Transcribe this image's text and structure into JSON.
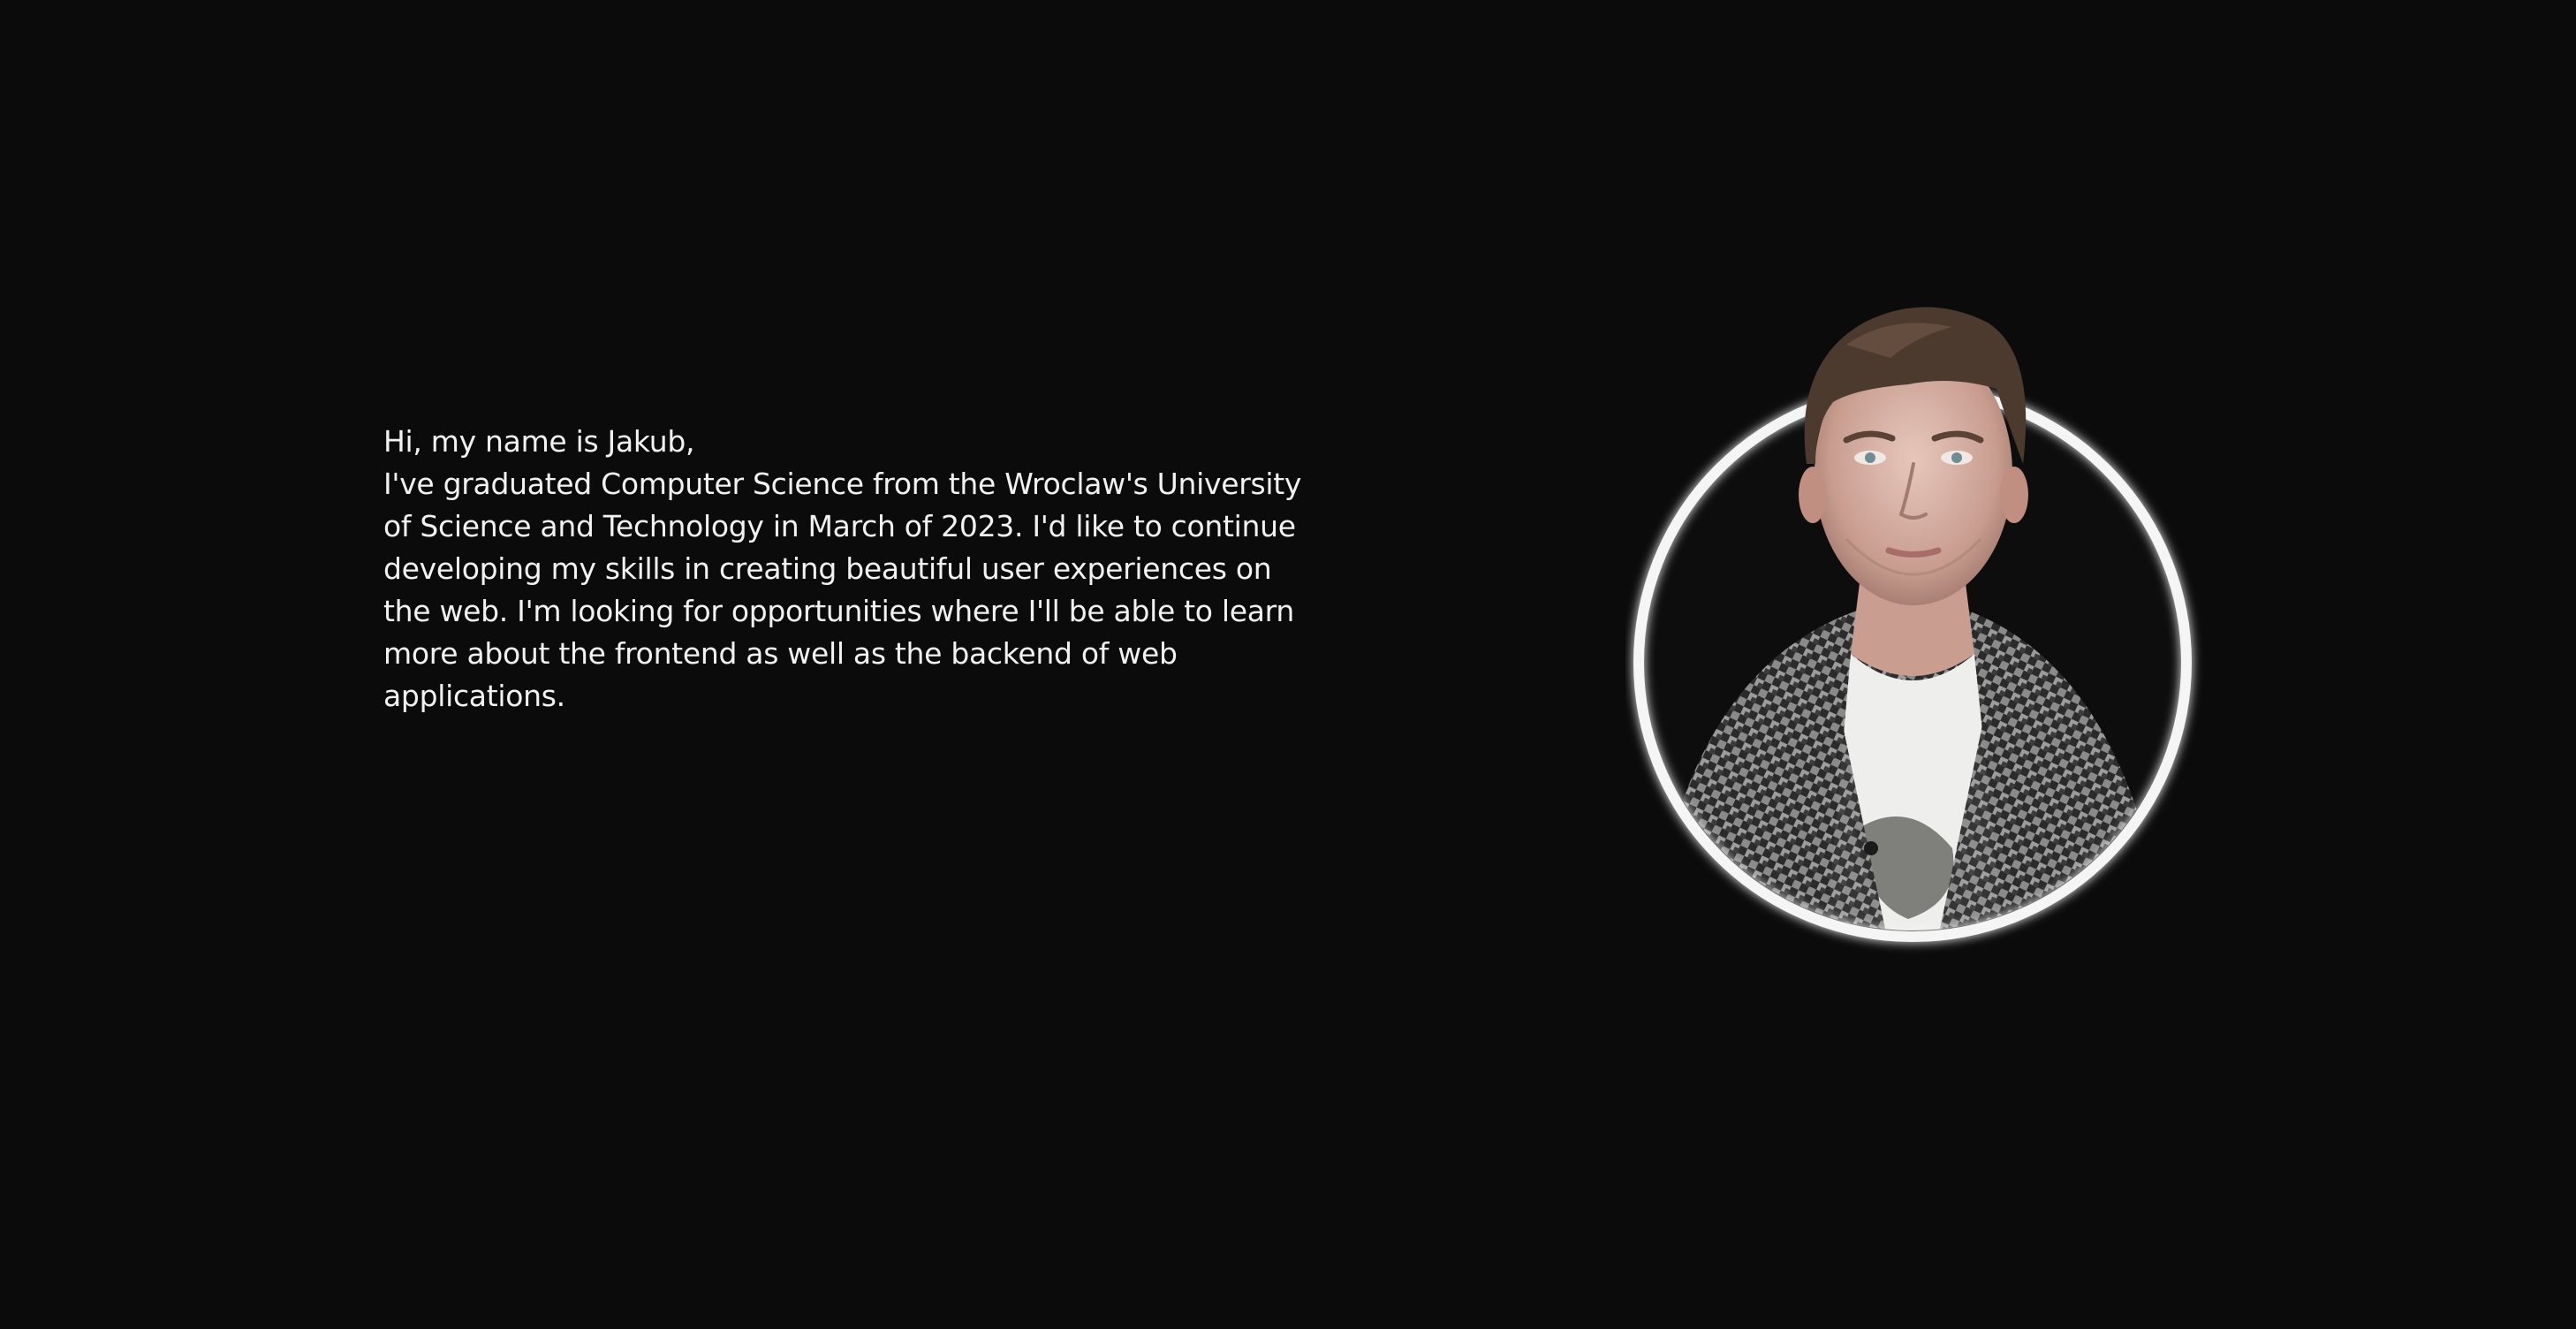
{
  "intro": {
    "greeting": "Hi, my name is Jakub,",
    "bio": "I've graduated Computer Science from the Wroclaw's University of Science and Technology in March of 2023. I'd like to continue developing my skills in creating beautiful user experiences on the web. I'm looking for opportunities where I'll be able to learn more about the frontend as well as the backend of web applications."
  },
  "colors": {
    "background": "#0b0b0b",
    "text": "#f2f2f2",
    "ring": "#f5f5f5"
  },
  "icons": [
    "profile-photo"
  ]
}
